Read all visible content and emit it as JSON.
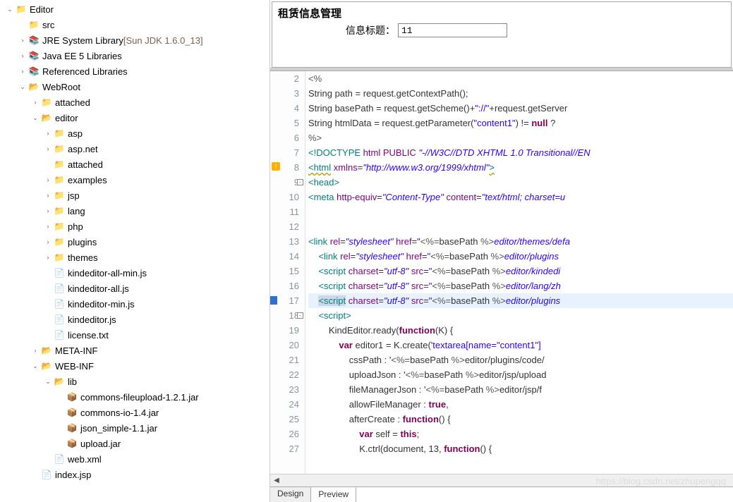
{
  "tree": [
    {
      "depth": 0,
      "twisty": "open",
      "icon": "proj",
      "label": "Editor"
    },
    {
      "depth": 1,
      "twisty": "none",
      "icon": "folder",
      "label": "src"
    },
    {
      "depth": 1,
      "twisty": "closed",
      "icon": "lib",
      "label": "JRE System Library",
      "deco": "[Sun JDK 1.6.0_13]"
    },
    {
      "depth": 1,
      "twisty": "closed",
      "icon": "lib",
      "label": "Java EE 5 Libraries"
    },
    {
      "depth": 1,
      "twisty": "closed",
      "icon": "lib",
      "label": "Referenced Libraries"
    },
    {
      "depth": 1,
      "twisty": "open",
      "icon": "folder-open",
      "label": "WebRoot"
    },
    {
      "depth": 2,
      "twisty": "closed",
      "icon": "folder",
      "label": "attached"
    },
    {
      "depth": 2,
      "twisty": "open",
      "icon": "folder-open",
      "label": "editor"
    },
    {
      "depth": 3,
      "twisty": "closed",
      "icon": "folder",
      "label": "asp"
    },
    {
      "depth": 3,
      "twisty": "closed",
      "icon": "folder",
      "label": "asp.net"
    },
    {
      "depth": 3,
      "twisty": "none",
      "icon": "folder",
      "label": "attached"
    },
    {
      "depth": 3,
      "twisty": "closed",
      "icon": "folder",
      "label": "examples"
    },
    {
      "depth": 3,
      "twisty": "closed",
      "icon": "folder",
      "label": "jsp"
    },
    {
      "depth": 3,
      "twisty": "closed",
      "icon": "folder",
      "label": "lang"
    },
    {
      "depth": 3,
      "twisty": "closed",
      "icon": "folder",
      "label": "php"
    },
    {
      "depth": 3,
      "twisty": "closed",
      "icon": "folder",
      "label": "plugins"
    },
    {
      "depth": 3,
      "twisty": "closed",
      "icon": "folder",
      "label": "themes"
    },
    {
      "depth": 3,
      "twisty": "none",
      "icon": "js",
      "label": "kindeditor-all-min.js"
    },
    {
      "depth": 3,
      "twisty": "none",
      "icon": "js",
      "label": "kindeditor-all.js"
    },
    {
      "depth": 3,
      "twisty": "none",
      "icon": "js",
      "label": "kindeditor-min.js"
    },
    {
      "depth": 3,
      "twisty": "none",
      "icon": "js",
      "label": "kindeditor.js"
    },
    {
      "depth": 3,
      "twisty": "none",
      "icon": "txt",
      "label": "license.txt"
    },
    {
      "depth": 2,
      "twisty": "closed",
      "icon": "folder-open",
      "label": "META-INF"
    },
    {
      "depth": 2,
      "twisty": "open",
      "icon": "folder-open",
      "label": "WEB-INF"
    },
    {
      "depth": 3,
      "twisty": "open",
      "icon": "folder-open",
      "label": "lib"
    },
    {
      "depth": 4,
      "twisty": "none",
      "icon": "jar",
      "label": "commons-fileupload-1.2.1.jar"
    },
    {
      "depth": 4,
      "twisty": "none",
      "icon": "jar",
      "label": "commons-io-1.4.jar"
    },
    {
      "depth": 4,
      "twisty": "none",
      "icon": "jar",
      "label": "json_simple-1.1.jar"
    },
    {
      "depth": 4,
      "twisty": "none",
      "icon": "jar",
      "label": "upload.jar"
    },
    {
      "depth": 3,
      "twisty": "none",
      "icon": "xml",
      "label": "web.xml"
    },
    {
      "depth": 2,
      "twisty": "none",
      "icon": "jsp",
      "label": "index.jsp"
    }
  ],
  "preview": {
    "title": "租赁信息管理",
    "label": "信息标题：",
    "value": "11"
  },
  "code": {
    "lines": [
      {
        "n": 2,
        "html": "<span class='jsp-e'>&lt;%</span>"
      },
      {
        "n": 3,
        "html": "String path = request.getContextPath();"
      },
      {
        "n": 4,
        "html": "String basePath = request.getScheme()+<span class='str'>\"://\"</span>+request.getServer"
      },
      {
        "n": 5,
        "html": "String htmlData = request.getParameter(<span class='str'>\"content1\"</span>) != <span class='kw'>null</span> ? "
      },
      {
        "n": 6,
        "html": "<span class='jsp-e'>%&gt;</span>"
      },
      {
        "n": 7,
        "html": "<span class='tag'>&lt;!DOCTYPE</span> <span class='attrn'>html</span> <span class='attrn'>PUBLIC</span> <span class='italv'>\"-//W3C//DTD XHTML 1.0 Transitional//EN</span>"
      },
      {
        "n": 8,
        "warn": true,
        "html": "<span class='tag underline-wave'>&lt;html</span> <span class='attrn'>xmlns</span>=<span class='italv'>\"http://www.w3.org/1999/xhtml\"</span><span class='tag underline-wave'>&gt;</span>"
      },
      {
        "n": 9,
        "fold": true,
        "html": "<span class='tag'>&lt;head&gt;</span>"
      },
      {
        "n": 10,
        "html": "<span class='tag'>&lt;meta</span> <span class='attrn'>http-equiv</span>=<span class='italv'>\"Content-Type\"</span> <span class='attrn'>content</span>=<span class='italv'>\"text/html; charset=u</span>"
      },
      {
        "n": 11,
        "html": ""
      },
      {
        "n": 12,
        "html": ""
      },
      {
        "n": 13,
        "html": "<span class='tag'>&lt;link</span> <span class='attrn'>rel</span>=<span class='italv'>\"stylesheet\"</span> <span class='attrn'>href</span>=<span class='str'>\"</span><span class='jsp-e'>&lt;%=</span>basePath <span class='jsp-e'>%&gt;</span><span class='italv'>editor/themes/defa</span>"
      },
      {
        "n": 14,
        "html": "    <span class='tag'>&lt;link</span> <span class='attrn'>rel</span>=<span class='italv'>\"stylesheet\"</span> <span class='attrn'>href</span>=<span class='str'>\"</span><span class='jsp-e'>&lt;%=</span>basePath <span class='jsp-e'>%&gt;</span><span class='italv'>editor/plugins</span>"
      },
      {
        "n": 15,
        "html": "    <span class='tag'>&lt;script</span> <span class='attrn'>charset</span>=<span class='italv'>\"utf-8\"</span> <span class='attrn'>src</span>=<span class='str'>\"</span><span class='jsp-e'>&lt;%=</span>basePath <span class='jsp-e'>%&gt;</span><span class='italv'>editor/kindedi</span>"
      },
      {
        "n": 16,
        "html": "    <span class='tag'>&lt;script</span> <span class='attrn'>charset</span>=<span class='italv'>\"utf-8\"</span> <span class='attrn'>src</span>=<span class='str'>\"</span><span class='jsp-e'>&lt;%=</span>basePath <span class='jsp-e'>%&gt;</span><span class='italv'>editor/lang/zh</span>"
      },
      {
        "n": 17,
        "hl": true,
        "mark": true,
        "html": "    <span class='tag' style='background:#ccd8e8'>&lt;script</span> <span class='attrn'>charset</span>=<span class='italv'>\"utf-8\"</span> <span class='attrn'>src</span>=<span class='str'>\"</span><span class='jsp-e'>&lt;%=</span>basePath <span class='jsp-e'>%&gt;</span><span class='italv'>editor/plugins</span>"
      },
      {
        "n": 18,
        "fold": true,
        "html": "    <span class='tag'>&lt;script&gt;</span>"
      },
      {
        "n": 19,
        "html": "        KindEditor.ready(<span class='kw'>function</span>(K) {"
      },
      {
        "n": 20,
        "html": "            <span class='kw'>var</span> editor1 = K.create(<span class='str'>'textarea[name=\"content1\"]</span>"
      },
      {
        "n": 21,
        "html": "                cssPath : <span class='str'>'</span><span class='jsp-e'>&lt;%=</span>basePath <span class='jsp-e'>%&gt;</span>editor/plugins/code/"
      },
      {
        "n": 22,
        "html": "                uploadJson : <span class='str'>'</span><span class='jsp-e'>&lt;%=</span>basePath <span class='jsp-e'>%&gt;</span>editor/jsp/upload"
      },
      {
        "n": 23,
        "html": "                fileManagerJson : <span class='str'>'</span><span class='jsp-e'>&lt;%=</span>basePath <span class='jsp-e'>%&gt;</span>editor/jsp/f"
      },
      {
        "n": 24,
        "html": "                allowFileManager : <span class='kw'>true</span>,"
      },
      {
        "n": 25,
        "html": "                afterCreate : <span class='kw'>function</span>() {"
      },
      {
        "n": 26,
        "html": "                    <span class='kw'>var</span> self = <span class='kw'>this</span>;"
      },
      {
        "n": 27,
        "html": "                    K.ctrl(document, 13, <span class='kw'>function</span>() {"
      }
    ]
  },
  "tabs": {
    "design": "Design",
    "preview": "Preview"
  },
  "watermark": "https://blog.csdn.net/zhupengqq"
}
